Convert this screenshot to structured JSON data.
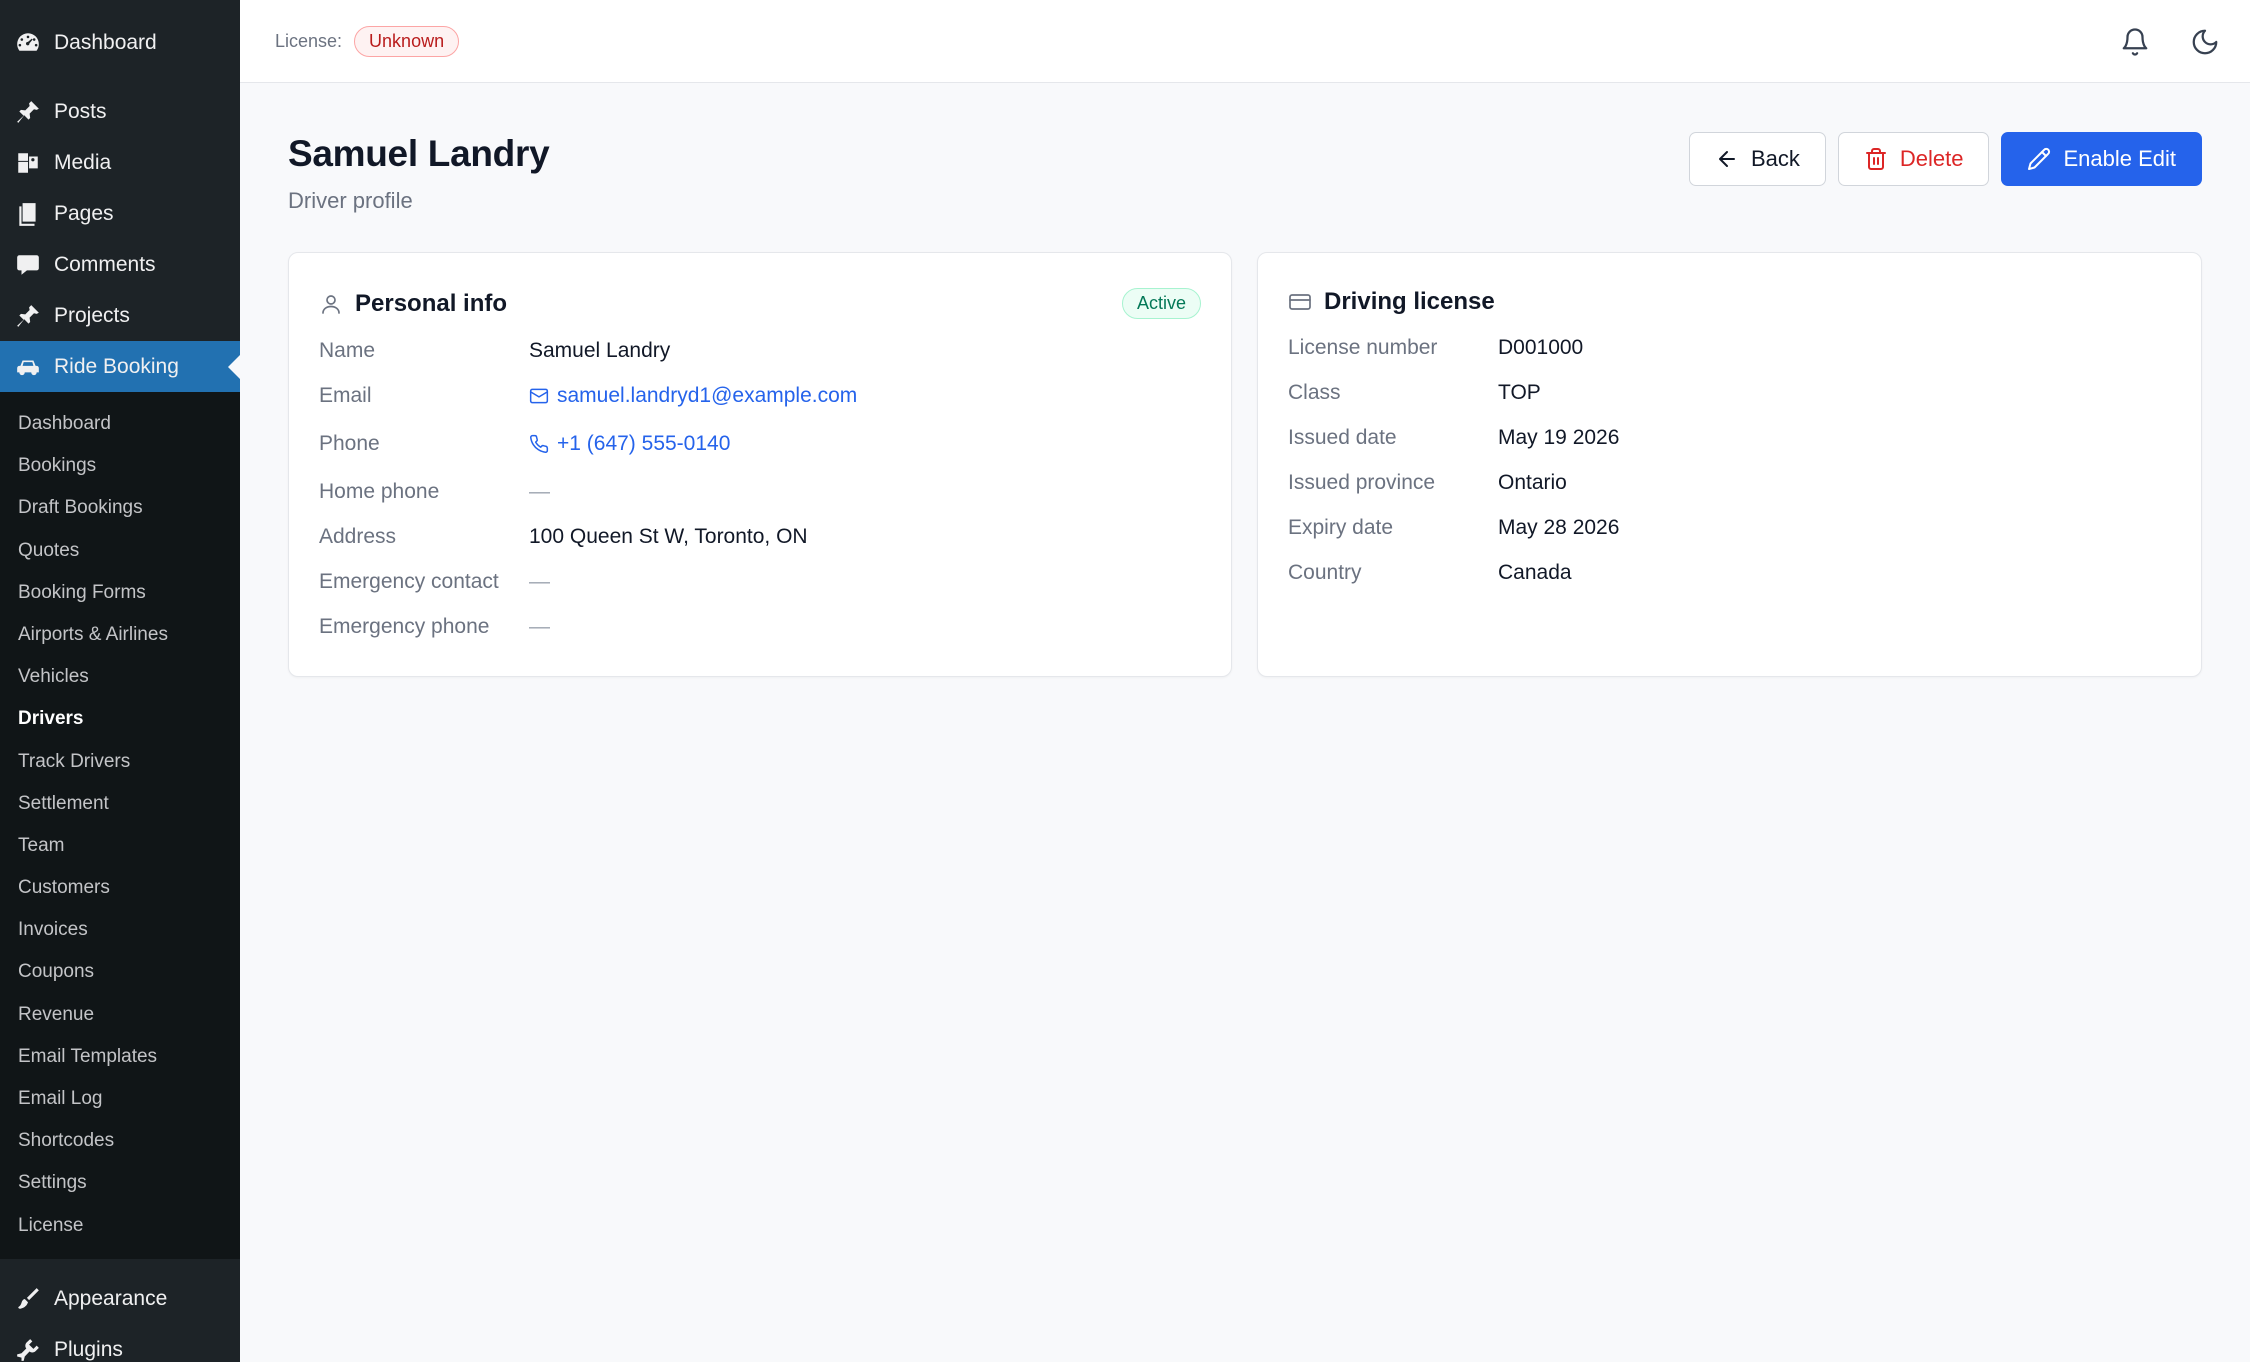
{
  "sidebar": {
    "top_items": [
      {
        "label": "Dashboard",
        "icon": "dashboard-icon"
      },
      {
        "label": "Posts",
        "icon": "pin-icon"
      },
      {
        "label": "Media",
        "icon": "media-icon"
      },
      {
        "label": "Pages",
        "icon": "pages-icon"
      },
      {
        "label": "Comments",
        "icon": "comment-icon"
      },
      {
        "label": "Projects",
        "icon": "pin-icon"
      },
      {
        "label": "Ride Booking",
        "icon": "car-icon"
      }
    ],
    "sub_items": [
      "Dashboard",
      "Bookings",
      "Draft Bookings",
      "Quotes",
      "Booking Forms",
      "Airports & Airlines",
      "Vehicles",
      "Drivers",
      "Track Drivers",
      "Settlement",
      "Team",
      "Customers",
      "Invoices",
      "Coupons",
      "Revenue",
      "Email Templates",
      "Email Log",
      "Shortcodes",
      "Settings",
      "License"
    ],
    "current_sub": "Drivers",
    "bottom_items": [
      {
        "label": "Appearance",
        "icon": "brush-icon"
      },
      {
        "label": "Plugins",
        "icon": "plugin-icon"
      }
    ]
  },
  "topbar": {
    "license_label": "License:",
    "license_status": "Unknown"
  },
  "page": {
    "title": "Samuel Landry",
    "subtitle": "Driver profile"
  },
  "actions": {
    "back_label": "Back",
    "delete_label": "Delete",
    "edit_label": "Enable Edit"
  },
  "personal_info": {
    "title": "Personal info",
    "status": "Active",
    "rows": [
      {
        "label": "Name",
        "value": "Samuel Landry"
      },
      {
        "label": "Email",
        "value": "samuel.landryd1@example.com"
      },
      {
        "label": "Phone",
        "value": "+1 (647) 555-0140"
      },
      {
        "label": "Home phone",
        "value": "—"
      },
      {
        "label": "Address",
        "value": "100 Queen St W, Toronto, ON"
      },
      {
        "label": "Emergency contact",
        "value": "—"
      },
      {
        "label": "Emergency phone",
        "value": "—"
      }
    ]
  },
  "driving_license": {
    "title": "Driving license",
    "rows": [
      {
        "label": "License number",
        "value": "D001000"
      },
      {
        "label": "Class",
        "value": "TOP"
      },
      {
        "label": "Issued date",
        "value": "May 19 2026"
      },
      {
        "label": "Issued province",
        "value": "Ontario"
      },
      {
        "label": "Expiry date",
        "value": "May 28 2026"
      },
      {
        "label": "Country",
        "value": "Canada"
      }
    ]
  },
  "colors": {
    "sidebar_bg": "#1d2327",
    "sidebar_active": "#2271b1",
    "primary": "#2563eb",
    "danger": "#dc2626",
    "success": "#047857"
  }
}
